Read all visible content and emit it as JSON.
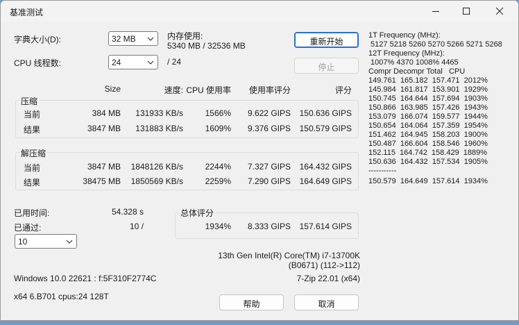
{
  "window": {
    "title": "基准测试"
  },
  "settings": {
    "dict_label": "字典大小(D):",
    "dict_value": "32 MB",
    "threads_label": "CPU 线程数:",
    "threads_value": "24",
    "threads_total": "/ 24",
    "memory_label": "内存使用:",
    "memory_value": "5340 MB / 32536 MB"
  },
  "buttons": {
    "restart": "重新开始",
    "stop": "停止",
    "help": "帮助",
    "cancel": "取消"
  },
  "table": {
    "headers": {
      "size": "Size",
      "speed": "速度:",
      "cpu": "CPU 使用率",
      "rating_usage": "使用率评分",
      "rating": "评分"
    },
    "compress": {
      "title": "压缩",
      "rows": [
        {
          "label": "当前",
          "size": "384 MB",
          "speed": "131933 KB/s",
          "cpu": "1566%",
          "rating_usage": "9.622 GIPS",
          "rating": "150.636 GIPS"
        },
        {
          "label": "结果",
          "size": "3847 MB",
          "speed": "131883 KB/s",
          "cpu": "1609%",
          "rating_usage": "9.376 GIPS",
          "rating": "150.579 GIPS"
        }
      ]
    },
    "decompress": {
      "title": "解压缩",
      "rows": [
        {
          "label": "当前",
          "size": "3847 MB",
          "speed": "1848126 KB/s",
          "cpu": "2244%",
          "rating_usage": "7.327 GIPS",
          "rating": "164.432 GIPS"
        },
        {
          "label": "结果",
          "size": "38475 MB",
          "speed": "1850569 KB/s",
          "cpu": "2259%",
          "rating_usage": "7.290 GIPS",
          "rating": "164.649 GIPS"
        }
      ]
    }
  },
  "status": {
    "elapsed_label": "已用时间:",
    "elapsed_value": "54.328 s",
    "passes_label": "已通过:",
    "passes_value": "10 /",
    "passes_select": "10"
  },
  "total": {
    "title": "总体评分",
    "cpu": "1934%",
    "rating_usage": "8.333 GIPS",
    "rating": "157.614 GIPS"
  },
  "system": {
    "cpu_name": "13th Gen Intel(R) Core(TM) i7-13700K",
    "cpu_id": "(B0671) (112->112)",
    "os": "Windows 10.0 22621 : f:5F310F2774C",
    "version": "7-Zip 22.01 (x64)",
    "arch": "x64 6.B701 cpus:24 128T"
  },
  "log": [
    "1T Frequency (MHz):",
    " 5127 5218 5260 5270 5266 5271 5268",
    "12T Frequency (MHz):",
    " 1007% 4370 1008% 4465",
    "Compr Decompr Total   CPU",
    "149.761  165.182  157.471  2012%",
    "145.984  161.817  153.901  1929%",
    "150.745  164.644  157.694  1903%",
    "150.866  163.985  157.426  1943%",
    "153.079  166.074  159.577  1944%",
    "150.654  164.064  157.359  1954%",
    "151.462  164.945  158.203  1900%",
    "150.487  166.604  158.546  1960%",
    "152.115  164.742  158.429  1889%",
    "150.636  164.432  157.534  1905%",
    "-----------",
    "150.579  164.649  157.614  1934%"
  ]
}
